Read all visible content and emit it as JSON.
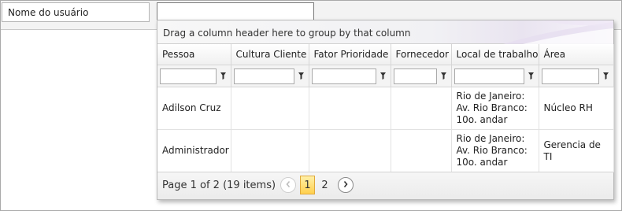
{
  "field_label": "Nome do usuário",
  "combo": {
    "value": ""
  },
  "group_panel": {
    "text": "Drag a column header here to group by that column"
  },
  "columns": [
    "Pessoa",
    "Cultura Cliente",
    "Fator Prioridade",
    "Fornecedor",
    "Local de trabalho",
    "Área"
  ],
  "rows": [
    {
      "pessoa": "Adilson Cruz",
      "cultura": "",
      "fator": "",
      "fornecedor": "",
      "local": "Rio de Janeiro: Av. Rio Branco: 10o. andar",
      "area": "Núcleo RH"
    },
    {
      "pessoa": "Administrador",
      "cultura": "",
      "fator": "",
      "fornecedor": "",
      "local": "Rio de Janeiro: Av. Rio Branco: 10o. andar",
      "area": "Gerencia de TI"
    }
  ],
  "pager": {
    "info": "Page 1 of 2 (19 items)",
    "pages": [
      "1",
      "2"
    ],
    "current": "1"
  },
  "icons": {
    "filter": "funnel-icon",
    "prev": "chevron-left-icon",
    "next": "chevron-right-icon"
  },
  "colors": {
    "current_page": "#ffd04e",
    "border": "#a9a9a9"
  }
}
